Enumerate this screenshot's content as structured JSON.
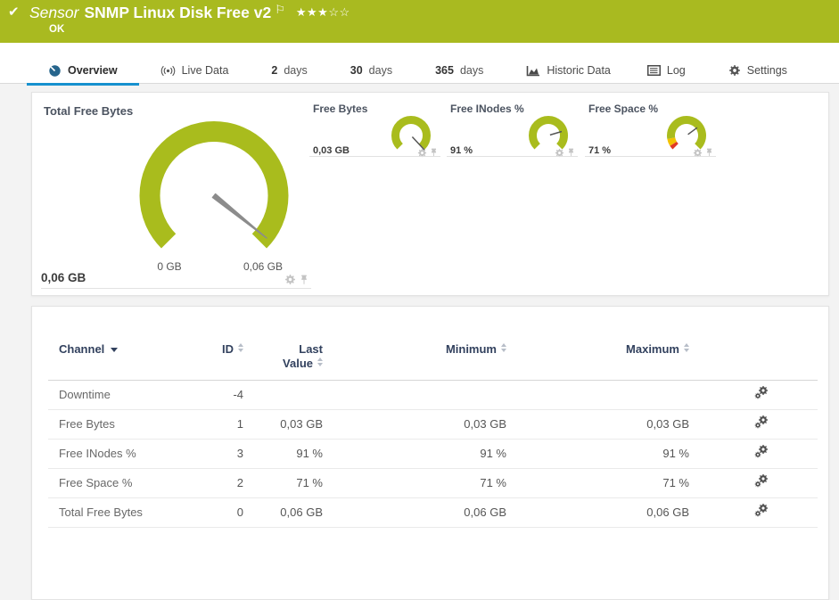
{
  "header": {
    "kind": "Sensor",
    "title": "SNMP Linux Disk Free v2",
    "status": "OK",
    "rating": {
      "filled": 3,
      "total": 5
    },
    "bar_color": "#a9ba20"
  },
  "tabs": [
    {
      "label": "Overview",
      "active": true
    },
    {
      "label": "Live Data"
    },
    {
      "num": "2",
      "unit": "days"
    },
    {
      "num": "30",
      "unit": "days"
    },
    {
      "num": "365",
      "unit": "days"
    },
    {
      "label": "Historic Data"
    },
    {
      "label": "Log"
    },
    {
      "label": "Settings"
    }
  ],
  "overview": {
    "main_gauge": {
      "title": "Total Free Bytes",
      "value": "0,06 GB",
      "scale_min": "0 GB",
      "scale_max": "0,06 GB"
    },
    "mini_gauges": [
      {
        "title": "Free Bytes",
        "value": "0,03 GB"
      },
      {
        "title": "Free INodes %",
        "value": "91 %"
      },
      {
        "title": "Free Space %",
        "value": "71 %"
      }
    ],
    "gauge_color": "#a9bc1d",
    "warn_color": "#f3c200",
    "error_color": "#e03b24"
  },
  "table": {
    "headers": {
      "channel": "Channel",
      "id": "ID",
      "last": "Last Value",
      "min": "Minimum",
      "max": "Maximum"
    },
    "rows": [
      {
        "channel": "Downtime",
        "id": "-4",
        "last": "",
        "min": "",
        "max": ""
      },
      {
        "channel": "Free Bytes",
        "id": "1",
        "last": "0,03 GB",
        "min": "0,03 GB",
        "max": "0,03 GB"
      },
      {
        "channel": "Free INodes %",
        "id": "3",
        "last": "91 %",
        "min": "91 %",
        "max": "91 %"
      },
      {
        "channel": "Free Space %",
        "id": "2",
        "last": "71 %",
        "min": "71 %",
        "max": "71 %"
      },
      {
        "channel": "Total Free Bytes",
        "id": "0",
        "last": "0,06 GB",
        "min": "0,06 GB",
        "max": "0,06 GB"
      }
    ]
  }
}
